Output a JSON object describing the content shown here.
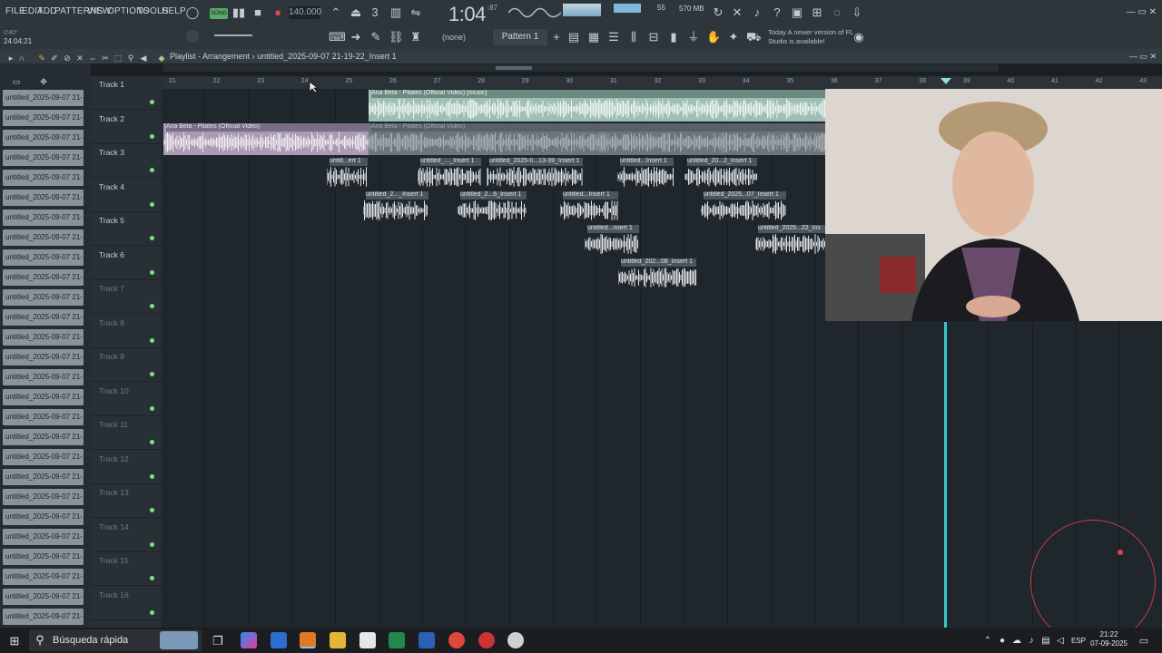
{
  "menu": [
    "FILE",
    "EDIT",
    "ADD",
    "PATTERNS",
    "VIEW",
    "OPTIONS",
    "TOOLS",
    "HELP"
  ],
  "transport": {
    "mode": "SONG",
    "tempo": "140.000",
    "time_main": "1:04",
    "time_sub": ":87",
    "time_top": "M:S:CS"
  },
  "stats": {
    "mem": "570 MB",
    "cpu": "55"
  },
  "toolbar2": {
    "readout": "24:04:21",
    "readout_small": "0'40\"",
    "channel_none": "(none)",
    "pattern": "Pattern 1",
    "news": "Today A newer version of FL Studio is available!"
  },
  "playlist": {
    "title": "Playlist - Arrangement",
    "breadcrumb": "untitled_2025-09-07 21-19-22_Insert 1"
  },
  "picker_item": "untitled_2025-09-07 21-...",
  "tracks": [
    "Track 1",
    "Track 2",
    "Track 3",
    "Track 4",
    "Track 5",
    "Track 6",
    "Track 7",
    "Track 8",
    "Track 9",
    "Track 10",
    "Track 11",
    "Track 12",
    "Track 13",
    "Track 14",
    "Track 15",
    "Track 16"
  ],
  "ruler": [
    "21",
    "22",
    "23",
    "24",
    "25",
    "26",
    "27",
    "28",
    "29",
    "30",
    "31",
    "32",
    "33",
    "34",
    "35",
    "36",
    "37",
    "38",
    "39",
    "40",
    "41",
    "42",
    "43"
  ],
  "clips": {
    "t1": "Aria Bela - Pilates (Official Video) [music]",
    "t2a": "Aria Bela - Pilates (Official Video)",
    "t2b": "Aria Bela - Pilates (Official Video)",
    "t3": [
      "untitl...ert 1",
      "untitled_..._Insert 1",
      "untitled_2025-0...13-39_Insert 1",
      "untitled...Insert 1",
      "untitled_20...2_Insert 1"
    ],
    "t4": [
      "untitled_2..._Insert 1",
      "untitled_2...6_Insert 1",
      "untitled...Insert 1",
      "untitled_2025...07_Insert 1"
    ],
    "t5": [
      "untitled...nsert 1",
      "untitled_2025...22_Ins"
    ],
    "t6": [
      "untitled_202...08_Insert 1"
    ]
  },
  "taskbar": {
    "search": "Búsqueda rápida",
    "lang": "ESP",
    "time": "21:22",
    "date": "07-09-2025"
  },
  "colors": {
    "accent": "#39c6c9",
    "clip_track1": "#9fbfb5",
    "clip_track2": "#a89bb3",
    "led": "#7fe07f"
  }
}
